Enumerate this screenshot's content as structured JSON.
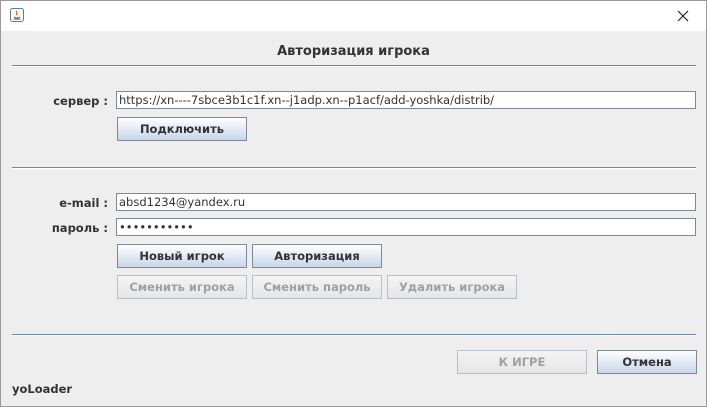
{
  "window": {
    "close_glyph": "✕",
    "icon": "java-app-icon"
  },
  "dialog": {
    "heading": "Авторизация игрока"
  },
  "server": {
    "label": "сервер :",
    "value": "https://xn----7sbce3b1c1f.xn--j1adp.xn--p1acf/add-yoshka/distrib/",
    "connect_label": "Подключить"
  },
  "auth": {
    "email_label": "e-mail :",
    "email_value": "absd1234@yandex.ru",
    "password_label": "пароль :",
    "password_value": "•••••••••••",
    "new_player_label": "Новый игрок",
    "login_label": "Авторизация",
    "change_player_label": "Сменить игрока",
    "change_password_label": "Сменить пароль",
    "delete_player_label": "Удалить игрока"
  },
  "footer": {
    "play_label": "К ИГРЕ",
    "cancel_label": "Отмена",
    "app_name": "yoLoader"
  },
  "colors": {
    "separator": "#6e86ad",
    "button_gradient_end": "#c8d6e8",
    "disabled_text": "#a0a0a0"
  }
}
